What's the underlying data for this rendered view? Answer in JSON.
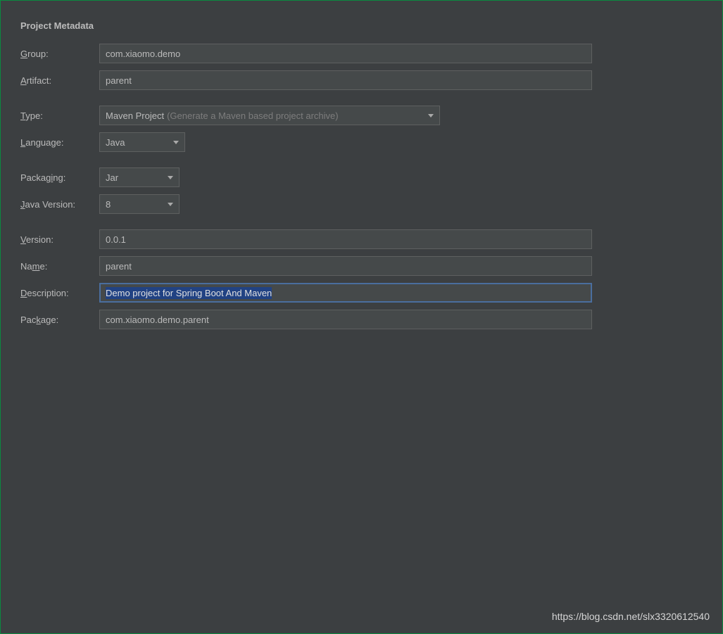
{
  "section": {
    "title": "Project Metadata"
  },
  "labels": {
    "group": {
      "pre": "",
      "u": "G",
      "post": "roup:"
    },
    "artifact": {
      "pre": "",
      "u": "A",
      "post": "rtifact:"
    },
    "type": {
      "pre": "",
      "u": "T",
      "post": "ype:"
    },
    "language": {
      "pre": "",
      "u": "L",
      "post": "anguage:"
    },
    "packaging": {
      "pre": "Packag",
      "u": "i",
      "post": "ng:"
    },
    "javaVersion": {
      "pre": "",
      "u": "J",
      "post": "ava Version:"
    },
    "version": {
      "pre": "",
      "u": "V",
      "post": "ersion:"
    },
    "name": {
      "pre": "Na",
      "u": "m",
      "post": "e:"
    },
    "description": {
      "pre": "",
      "u": "D",
      "post": "escription:"
    },
    "package": {
      "pre": "Pac",
      "u": "k",
      "post": "age:"
    }
  },
  "fields": {
    "group": "com.xiaomo.demo",
    "artifact": "parent",
    "type": {
      "value": "Maven Project",
      "hint": "(Generate a Maven based project archive)"
    },
    "language": "Java",
    "packaging": "Jar",
    "javaVersion": "8",
    "version": "0.0.1",
    "name": "parent",
    "description": "Demo project for Spring Boot And Maven",
    "package": "com.xiaomo.demo.parent"
  },
  "watermark": "https://blog.csdn.net/slx3320612540"
}
